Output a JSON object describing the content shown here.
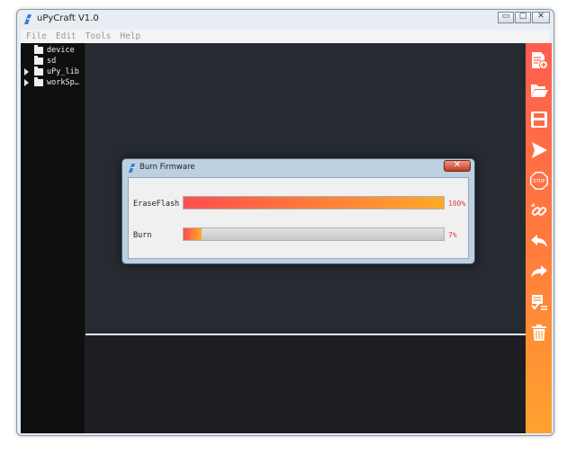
{
  "window": {
    "title": "uPyCraft V1.0",
    "controls": {
      "minimize": "▭",
      "maximize": "▢",
      "close": "✕"
    }
  },
  "menu": [
    "File",
    "Edit",
    "Tools",
    "Help"
  ],
  "file_tree": [
    {
      "label": "device",
      "expandable": false
    },
    {
      "label": "sd",
      "expandable": false
    },
    {
      "label": "uPy_lib",
      "expandable": true
    },
    {
      "label": "workSp…",
      "expandable": true
    }
  ],
  "toolbar": [
    {
      "name": "new-file-icon"
    },
    {
      "name": "open-folder-icon"
    },
    {
      "name": "save-icon"
    },
    {
      "name": "download-run-icon"
    },
    {
      "name": "stop-icon",
      "text": "STOP"
    },
    {
      "name": "connect-link-icon"
    },
    {
      "name": "undo-icon"
    },
    {
      "name": "redo-icon"
    },
    {
      "name": "syntax-check-icon"
    },
    {
      "name": "clear-trash-icon"
    }
  ],
  "dialog": {
    "title": "Burn Firmware",
    "close": "✕",
    "rows": [
      {
        "label": "EraseFlash",
        "percent_text": "100%",
        "progress": 1.0
      },
      {
        "label": "Burn",
        "percent_text": "7%",
        "progress": 0.07
      }
    ]
  },
  "colors": {
    "toolbar_top": "#ff5d4f",
    "toolbar_bottom": "#ffa22f",
    "progress_start": "#ff4f4f",
    "progress_end": "#ffa92a",
    "percent_text": "#e04040"
  }
}
